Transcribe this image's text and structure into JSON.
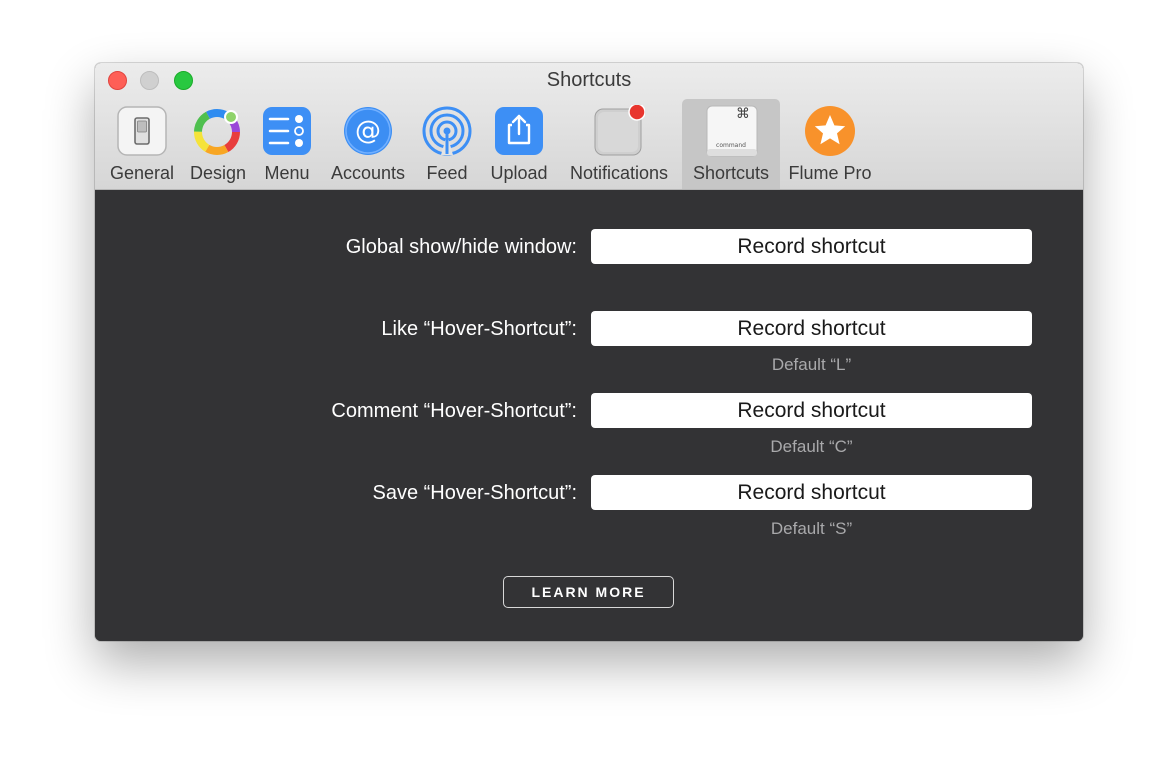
{
  "window": {
    "title": "Shortcuts"
  },
  "toolbar": {
    "items": [
      {
        "label": "General",
        "icon": "switch-icon"
      },
      {
        "label": "Design",
        "icon": "color-wheel-icon"
      },
      {
        "label": "Menu",
        "icon": "checklist-icon"
      },
      {
        "label": "Accounts",
        "icon": "at-sign-icon"
      },
      {
        "label": "Feed",
        "icon": "broadcast-icon"
      },
      {
        "label": "Upload",
        "icon": "share-upload-icon"
      },
      {
        "label": "Notifications",
        "icon": "notification-badge-icon"
      },
      {
        "label": "Shortcuts",
        "icon": "command-key-icon",
        "key_symbol": "⌘",
        "key_text": "command",
        "selected": true
      },
      {
        "label": "Flume Pro",
        "icon": "star-icon"
      }
    ]
  },
  "shortcuts": {
    "rows": [
      {
        "label": "Global show/hide window:",
        "button": "Record shortcut",
        "default": ""
      },
      {
        "label": "Like “Hover-Shortcut”:",
        "button": "Record shortcut",
        "default": "Default “L”"
      },
      {
        "label": "Comment “Hover-Shortcut”:",
        "button": "Record shortcut",
        "default": "Default “C”"
      },
      {
        "label": "Save “Hover-Shortcut”:",
        "button": "Record shortcut",
        "default": "Default “S”"
      }
    ],
    "learn_more": "LEARN MORE"
  },
  "colors": {
    "content_bg": "#333335",
    "close": "#fe5f57",
    "zoom": "#28c840",
    "accent_blue": "#3d8ff5",
    "pro_orange": "#f8922b",
    "badge_red": "#e8352e"
  }
}
